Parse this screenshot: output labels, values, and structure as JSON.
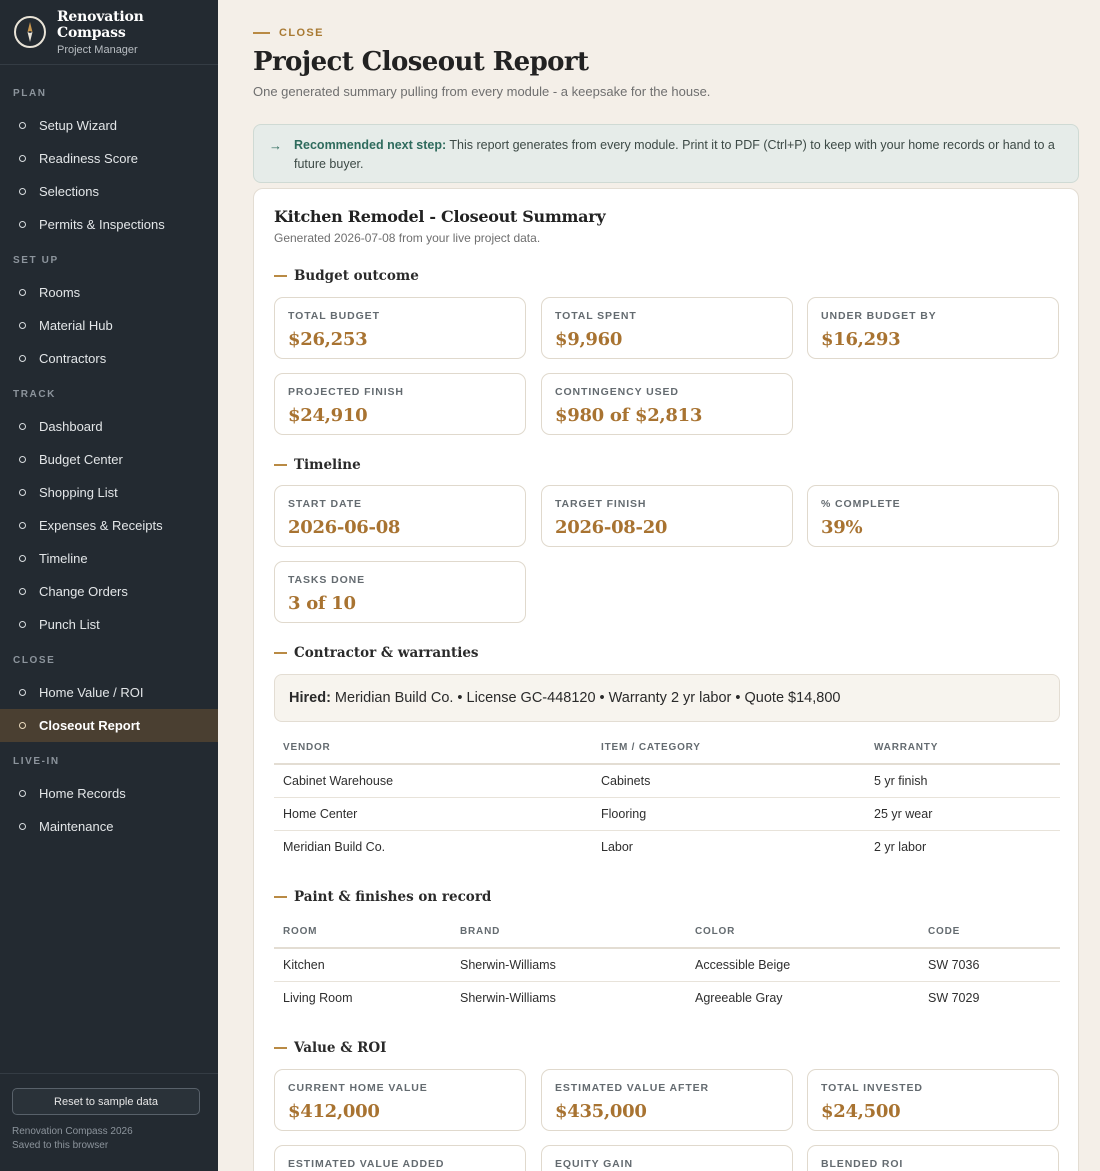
{
  "brand": {
    "title": "Renovation Compass",
    "subtitle": "Project Manager",
    "logo_icon": "compass-icon"
  },
  "nav": {
    "plan": {
      "label": "PLAN",
      "items": [
        "Setup Wizard",
        "Readiness Score",
        "Selections",
        "Permits & Inspections"
      ]
    },
    "setup": {
      "label": "SET UP",
      "items": [
        "Rooms",
        "Material Hub",
        "Contractors"
      ]
    },
    "track": {
      "label": "TRACK",
      "items": [
        "Dashboard",
        "Budget Center",
        "Shopping List",
        "Expenses & Receipts",
        "Timeline",
        "Change Orders",
        "Punch List"
      ]
    },
    "close": {
      "label": "CLOSE",
      "items": [
        "Home Value / ROI",
        "Closeout Report"
      ],
      "active": "Closeout Report"
    },
    "livein": {
      "label": "LIVE-IN",
      "items": [
        "Home Records",
        "Maintenance"
      ]
    }
  },
  "footer": {
    "reset_label": "Reset to sample data",
    "line1": "Renovation Compass 2026",
    "line2": "Saved to this browser"
  },
  "header": {
    "eyebrow": "CLOSE",
    "title": "Project Closeout Report",
    "subtitle": "One generated summary pulling from every module - a keepsake for the house."
  },
  "callout": {
    "lead": "Recommended next step:",
    "text": " This report generates from every module. Print it to PDF (Ctrl+P) to keep with your home records or hand to a future buyer."
  },
  "report": {
    "title": "Kitchen Remodel - Closeout Summary",
    "generated": "Generated 2026-07-08 from your live project data.",
    "budget": {
      "heading": "Budget outcome",
      "stats": [
        {
          "label": "TOTAL BUDGET",
          "value": "$26,253"
        },
        {
          "label": "TOTAL SPENT",
          "value": "$9,960"
        },
        {
          "label": "UNDER BUDGET BY",
          "value": "$16,293"
        },
        {
          "label": "PROJECTED FINISH",
          "value": "$24,910"
        },
        {
          "label": "CONTINGENCY USED",
          "value": "$980 of $2,813"
        }
      ]
    },
    "timeline": {
      "heading": "Timeline",
      "stats": [
        {
          "label": "START DATE",
          "value": "2026-06-08"
        },
        {
          "label": "TARGET FINISH",
          "value": "2026-08-20"
        },
        {
          "label": "% COMPLETE",
          "value": "39%"
        },
        {
          "label": "TASKS DONE",
          "value": "3 of 10"
        }
      ]
    },
    "contractor": {
      "heading": "Contractor & warranties",
      "hired_label": "Hired:",
      "hired_text": " Meridian Build Co. • License GC-448120 • Warranty 2 yr labor • Quote $14,800",
      "columns": [
        "VENDOR",
        "ITEM / CATEGORY",
        "WARRANTY"
      ],
      "rows": [
        [
          "Cabinet Warehouse",
          "Cabinets",
          "5 yr finish"
        ],
        [
          "Home Center",
          "Flooring",
          "25 yr wear"
        ],
        [
          "Meridian Build Co.",
          "Labor",
          "2 yr labor"
        ]
      ]
    },
    "paint": {
      "heading": "Paint & finishes on record",
      "columns": [
        "ROOM",
        "BRAND",
        "COLOR",
        "CODE"
      ],
      "rows": [
        [
          "Kitchen",
          "Sherwin-Williams",
          "Accessible Beige",
          "SW 7036"
        ],
        [
          "Living Room",
          "Sherwin-Williams",
          "Agreeable Gray",
          "SW 7029"
        ]
      ]
    },
    "roi": {
      "heading": "Value & ROI",
      "stats": [
        {
          "label": "CURRENT HOME VALUE",
          "value": "$412,000"
        },
        {
          "label": "ESTIMATED VALUE AFTER",
          "value": "$435,000"
        },
        {
          "label": "TOTAL INVESTED",
          "value": "$24,500"
        },
        {
          "label": "ESTIMATED VALUE ADDED",
          "value": ""
        },
        {
          "label": "EQUITY GAIN",
          "value": ""
        },
        {
          "label": "BLENDED ROI",
          "value": ""
        }
      ]
    }
  },
  "colors": {
    "sidebar": "#232a31",
    "accent": "#a87331",
    "active_nav": "#4a3f31",
    "callout_bg": "#e6ece9",
    "callout_accent": "#2f6b5d"
  }
}
